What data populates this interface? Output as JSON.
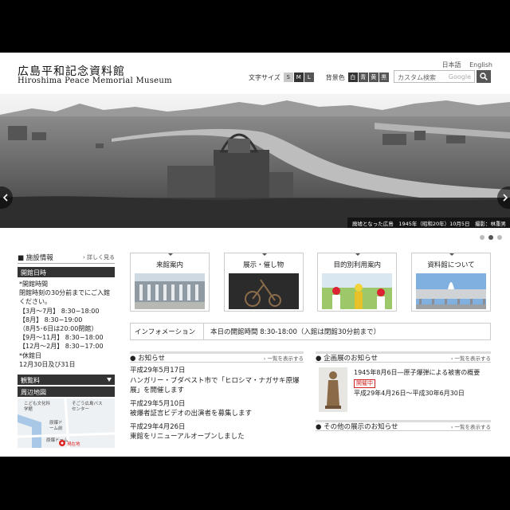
{
  "header": {
    "title_jp": "広島平和記念資料館",
    "title_en": "Hiroshima Peace Memorial Museum",
    "lang": [
      "日本語",
      "English"
    ],
    "text_size_label": "文字サイズ",
    "text_sizes": [
      "S",
      "M",
      "L"
    ],
    "bg_label": "背景色",
    "bg_colors": [
      "白",
      "青",
      "黄",
      "黒"
    ],
    "search_placeholder": "カスタム検索",
    "search_brand": "Google"
  },
  "hero": {
    "caption": "廃墟となった広島　1945年（昭和20年）10月5日　撮影：林重男"
  },
  "sidebar": {
    "facility_label": "施設情報",
    "detail_link": "詳しく見る",
    "hours_title": "開館日時",
    "hours_lines": [
      "*開館時間",
      "閉館時刻の30分前までにご入館",
      "ください。",
      "【3月〜7月】 8:30−18:00",
      "【8月】 8:30−19:00",
      "（8月5･6日は20:00閉館）",
      "【9月〜11月】 8:30−18:00",
      "【12月〜2月】 8:30−17:00",
      "*休館日",
      "12月30日及び31日"
    ],
    "fee_title": "観覧料",
    "map_title": "周辺地図",
    "map_labels": [
      "こども文化科学館",
      "そごう広島バスセンター",
      "原爆ドーム前",
      "原爆ドーム",
      "現在地"
    ]
  },
  "tiles": [
    {
      "label": "来館案内"
    },
    {
      "label": "展示・催し物"
    },
    {
      "label": "目的別利用案内"
    },
    {
      "label": "資料館について"
    }
  ],
  "info": {
    "label": "インフォメーション",
    "text": "本日の開館時間 8:30-18:00（入館は閉館30分前まで）"
  },
  "news": {
    "title": "お知らせ",
    "more": "一覧を表示する",
    "items": [
      {
        "date": "平成29年5月17日",
        "title": "ハンガリー・ブダペスト市で「ヒロシマ・ナガサキ原爆展」を開催します"
      },
      {
        "date": "平成29年5月10日",
        "title": "被爆者証言ビデオの出演者を募集します"
      },
      {
        "date": "平成29年4月26日",
        "title": "東館をリニューアルオープンしました"
      }
    ]
  },
  "exhibit": {
    "title": "企画展のお知らせ",
    "more": "一覧を表示する",
    "item_title": "1945年8月6日―原子爆弾による被害の概要",
    "badge": "開催中",
    "period": "平成29年4月26日〜平成30年6月30日",
    "other_title": "その他の展示のお知らせ",
    "other_more": "一覧を表示する"
  }
}
